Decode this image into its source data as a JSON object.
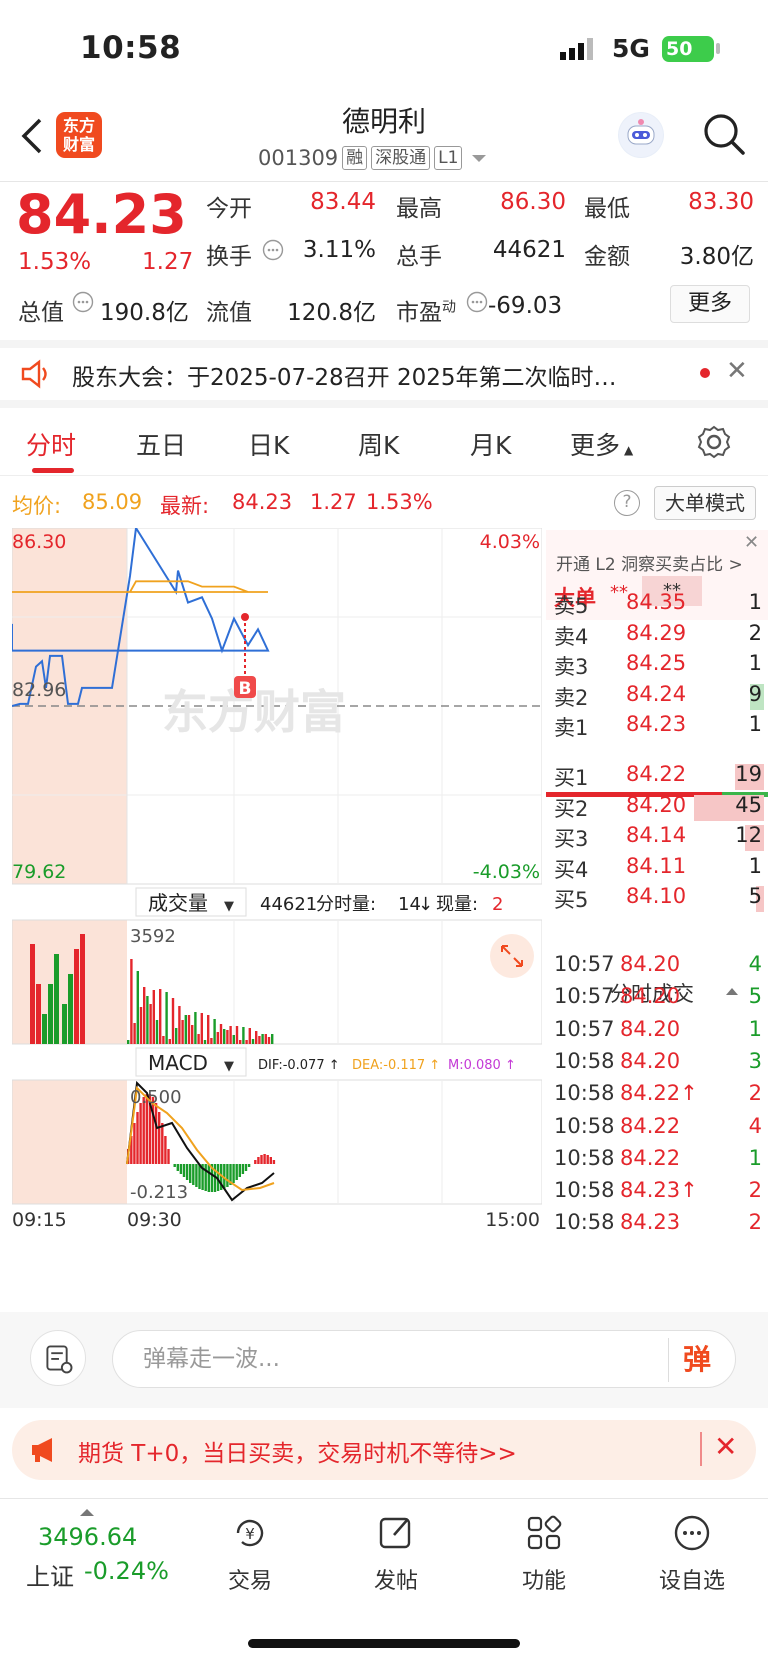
{
  "status": {
    "time": "10:58",
    "network": "5G",
    "battery": "50"
  },
  "header": {
    "logo_text": "东方财富",
    "stock_name": "德明利",
    "code": "001309",
    "tags": [
      "融",
      "深股通",
      "L1"
    ]
  },
  "quote": {
    "price": "84.23",
    "pct": "1.53%",
    "change": "1.27",
    "fields": [
      {
        "label": "今开",
        "value": "83.44",
        "color": "red"
      },
      {
        "label": "最高",
        "value": "86.30",
        "color": "red"
      },
      {
        "label": "最低",
        "value": "83.30",
        "color": "red"
      },
      {
        "label": "换手",
        "value": "3.11%",
        "color": "dark"
      },
      {
        "label": "总手",
        "value": "44621",
        "color": "dark"
      },
      {
        "label": "金额",
        "value": "3.80亿",
        "color": "dark"
      },
      {
        "label": "流值",
        "value": "120.8亿",
        "color": "dark"
      },
      {
        "label": "市盈",
        "sup": "动",
        "value": "-69.03",
        "color": "dark"
      }
    ],
    "total_value_label": "总值",
    "total_value": "190.8亿",
    "more_label": "更多"
  },
  "notice": {
    "text": "股东大会：于2025-07-28召开 2025年第二次临时…"
  },
  "tabs": [
    "分时",
    "五日",
    "日K",
    "周K",
    "月K",
    "更多"
  ],
  "info": {
    "avg_label": "均价:",
    "avg_value": "85.09",
    "latest_label": "最新:",
    "latest_value": "84.23",
    "latest_change": "1.27",
    "latest_pct": "1.53%",
    "mode_label": "大单模式"
  },
  "chart_data": {
    "type": "line",
    "title": "",
    "y_max": "86.30",
    "y_min": "79.62",
    "y_ref": "82.96",
    "pct_max": "4.03%",
    "pct_min": "-4.03%",
    "x_labels": [
      "09:15",
      "09:30",
      "15:00"
    ],
    "watermark": "东方财富",
    "marker": "B",
    "series": [
      {
        "name": "price",
        "color": "#2f6fd6",
        "values": [
          82.96,
          83.0,
          83.0,
          83.7,
          83.8,
          83.3,
          83.9,
          83.9,
          83.0,
          83.0,
          83.3,
          83.3,
          83.3,
          85.4,
          86.3,
          85.1,
          85.5,
          84.9,
          85.0,
          84.6,
          84.0,
          84.6,
          84.1,
          84.4,
          84.0,
          84.0,
          84.5
        ]
      },
      {
        "name": "avg",
        "color": "#f0a21e",
        "values": [
          null,
          null,
          null,
          null,
          null,
          null,
          null,
          null,
          null,
          null,
          null,
          null,
          null,
          85.1,
          85.3,
          85.3,
          85.3,
          85.3,
          85.2,
          85.2,
          85.2,
          85.2,
          85.1,
          85.1,
          85.1,
          85.1,
          85.09
        ]
      }
    ],
    "volume": {
      "selector": "成交量",
      "total": "44621",
      "fen_label": "分时量:",
      "fen_value": "14",
      "now_label": "现量:",
      "now_value": "2",
      "axis_top": "3592"
    },
    "macd": {
      "selector": "MACD",
      "dif": "DIF:-0.077 ↑",
      "dea": "DEA:-0.117 ↑",
      "m": "M:0.080 ↑",
      "axis_top": "0.500",
      "axis_bottom": "-0.213"
    }
  },
  "book": {
    "l2_text": "开通 L2 洞察买卖占比 >",
    "big_label": "大单",
    "big_stars": "**",
    "sells": [
      {
        "label": "卖5",
        "price": "84.35",
        "vol": "1",
        "bar": 0
      },
      {
        "label": "卖4",
        "price": "84.29",
        "vol": "2",
        "bar": 0
      },
      {
        "label": "卖3",
        "price": "84.25",
        "vol": "1",
        "bar": 0
      },
      {
        "label": "卖2",
        "price": "84.24",
        "vol": "9",
        "bar": 0.2,
        "green": true
      },
      {
        "label": "卖1",
        "price": "84.23",
        "vol": "1",
        "bar": 0
      }
    ],
    "buys": [
      {
        "label": "买1",
        "price": "84.22",
        "vol": "19",
        "bar": 0.42
      },
      {
        "label": "买2",
        "price": "84.20",
        "vol": "45",
        "bar": 1.0
      },
      {
        "label": "买3",
        "price": "84.14",
        "vol": "12",
        "bar": 0.27
      },
      {
        "label": "买4",
        "price": "84.11",
        "vol": "1",
        "bar": 0
      },
      {
        "label": "买5",
        "price": "84.10",
        "vol": "5",
        "bar": 0.11
      }
    ],
    "trades_title": "分时成交",
    "trades": [
      {
        "time": "10:57",
        "price": "84.20",
        "vol": "4",
        "red": false
      },
      {
        "time": "10:57",
        "price": "84.20",
        "vol": "5",
        "red": false
      },
      {
        "time": "10:57",
        "price": "84.20",
        "vol": "1",
        "red": false
      },
      {
        "time": "10:58",
        "price": "84.20",
        "vol": "3",
        "red": false
      },
      {
        "time": "10:58",
        "price": "84.22↑",
        "vol": "2",
        "red": true
      },
      {
        "time": "10:58",
        "price": "84.22",
        "vol": "4",
        "red": true
      },
      {
        "time": "10:58",
        "price": "84.22",
        "vol": "1",
        "red": false
      },
      {
        "time": "10:58",
        "price": "84.23↑",
        "vol": "2",
        "red": true
      },
      {
        "time": "10:58",
        "price": "84.23",
        "vol": "2",
        "red": true
      }
    ]
  },
  "comment": {
    "placeholder": "弹幕走一波...",
    "send_label": "弹"
  },
  "promo": {
    "text": "期货 T+0，当日买卖，交易时机不等待>>"
  },
  "bottom": {
    "index_value": "3496.64",
    "index_name": "上证",
    "index_pct": "-0.24%",
    "nav": [
      "交易",
      "发帖",
      "功能",
      "设自选"
    ]
  }
}
